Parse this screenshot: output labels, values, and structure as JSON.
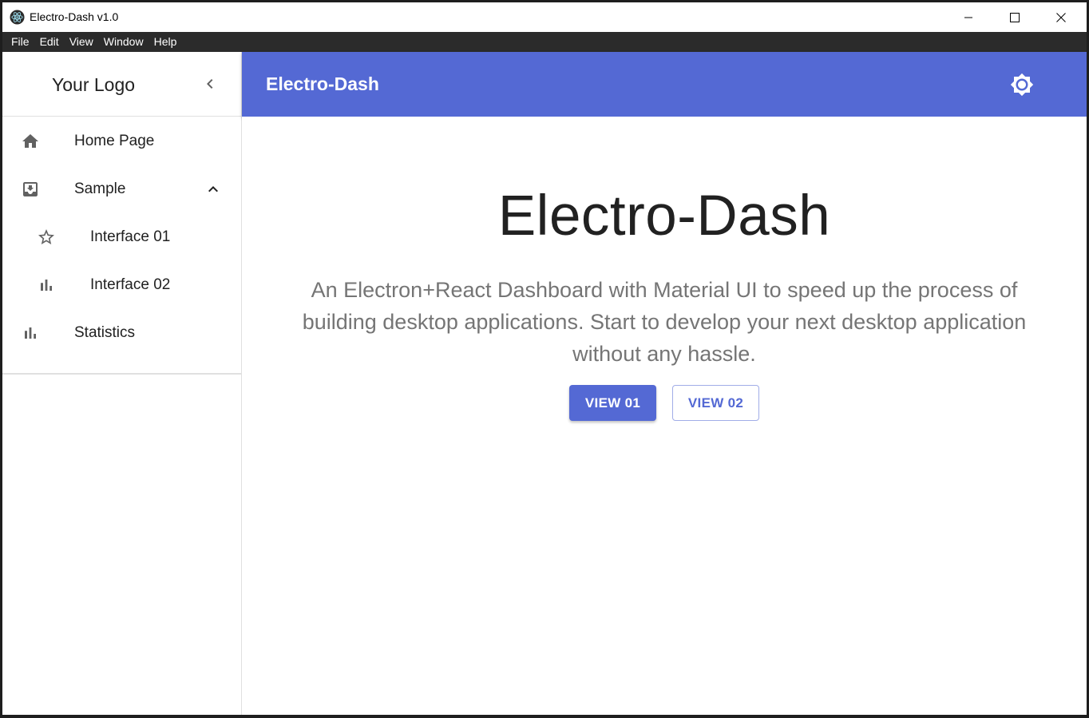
{
  "window": {
    "title": "Electro-Dash v1.0",
    "controls": [
      "minimize-icon",
      "maximize-icon",
      "close-icon"
    ]
  },
  "menubar": {
    "items": [
      "File",
      "Edit",
      "View",
      "Window",
      "Help"
    ]
  },
  "sidebar": {
    "logo": "Your Logo",
    "collapse_icon": "chevron-left-icon",
    "items": [
      {
        "label": "Home Page",
        "icon": "home-icon"
      },
      {
        "label": "Sample",
        "icon": "inbox-arrow-icon",
        "expanded": true,
        "expand_icon": "chevron-up-icon"
      },
      {
        "label": "Interface 01",
        "icon": "star-outline-icon"
      },
      {
        "label": "Interface 02",
        "icon": "bar-chart-icon"
      },
      {
        "label": "Statistics",
        "icon": "bar-chart-icon"
      }
    ]
  },
  "appbar": {
    "title": "Electro-Dash",
    "theme_icon": "brightness-icon"
  },
  "main": {
    "title": "Electro-Dash",
    "description": "An Electron+React Dashboard with Material UI to speed up the process of building desktop applications. Start to develop your next desktop application without any hassle.",
    "primary_button": "VIEW 01",
    "secondary_button": "VIEW 02"
  },
  "colors": {
    "primary": "#5469d4",
    "menubar_bg": "#2b2b2b",
    "text_primary": "#212121",
    "text_secondary": "#757575",
    "icon_gray": "#616161"
  }
}
